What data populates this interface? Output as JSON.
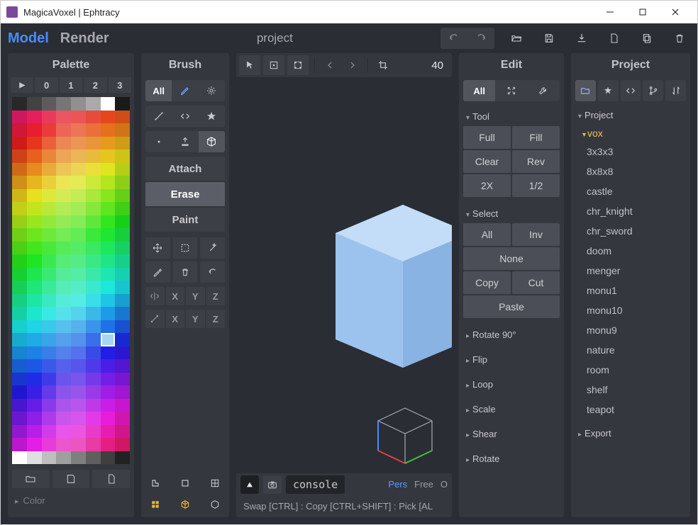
{
  "titlebar": {
    "title": "MagicaVoxel | Ephtracy"
  },
  "menubar": {
    "tabs": {
      "model": "Model",
      "render": "Render"
    },
    "project_name": "project"
  },
  "palette": {
    "header": "Palette",
    "tabs": [
      "0",
      "1",
      "2",
      "3"
    ],
    "bottom_expand": "Color"
  },
  "brush": {
    "header": "Brush",
    "all": "All",
    "modes": {
      "attach": "Attach",
      "erase": "Erase",
      "paint": "Paint"
    },
    "axis": {
      "x": "X",
      "y": "Y",
      "z": "Z"
    }
  },
  "viewport": {
    "size_value": "40",
    "console": "console",
    "cam_modes": {
      "pers": "Pers",
      "free": "Free",
      "orth": "O"
    },
    "hint": "Swap [CTRL] : Copy [CTRL+SHIFT] : Pick [AL"
  },
  "edit": {
    "header": "Edit",
    "all": "All",
    "sections": {
      "tool": "Tool",
      "select": "Select",
      "rotate90": "Rotate 90°",
      "flip": "Flip",
      "loop": "Loop",
      "scale": "Scale",
      "shear": "Shear",
      "rotate": "Rotate"
    },
    "tool_btns": {
      "full": "Full",
      "fill": "Fill",
      "clear": "Clear",
      "rev": "Rev",
      "x2": "2X",
      "half": "1/2"
    },
    "select_btns": {
      "all": "All",
      "inv": "Inv",
      "none": "None",
      "copy": "Copy",
      "cut": "Cut",
      "paste": "Paste"
    }
  },
  "project": {
    "header": "Project",
    "tree_header": "Project",
    "folder": "vox",
    "items": [
      "3x3x3",
      "8x8x8",
      "castle",
      "chr_knight",
      "chr_sword",
      "doom",
      "menger",
      "monu1",
      "monu10",
      "monu9",
      "nature",
      "room",
      "shelf",
      "teapot"
    ],
    "export": "Export"
  }
}
